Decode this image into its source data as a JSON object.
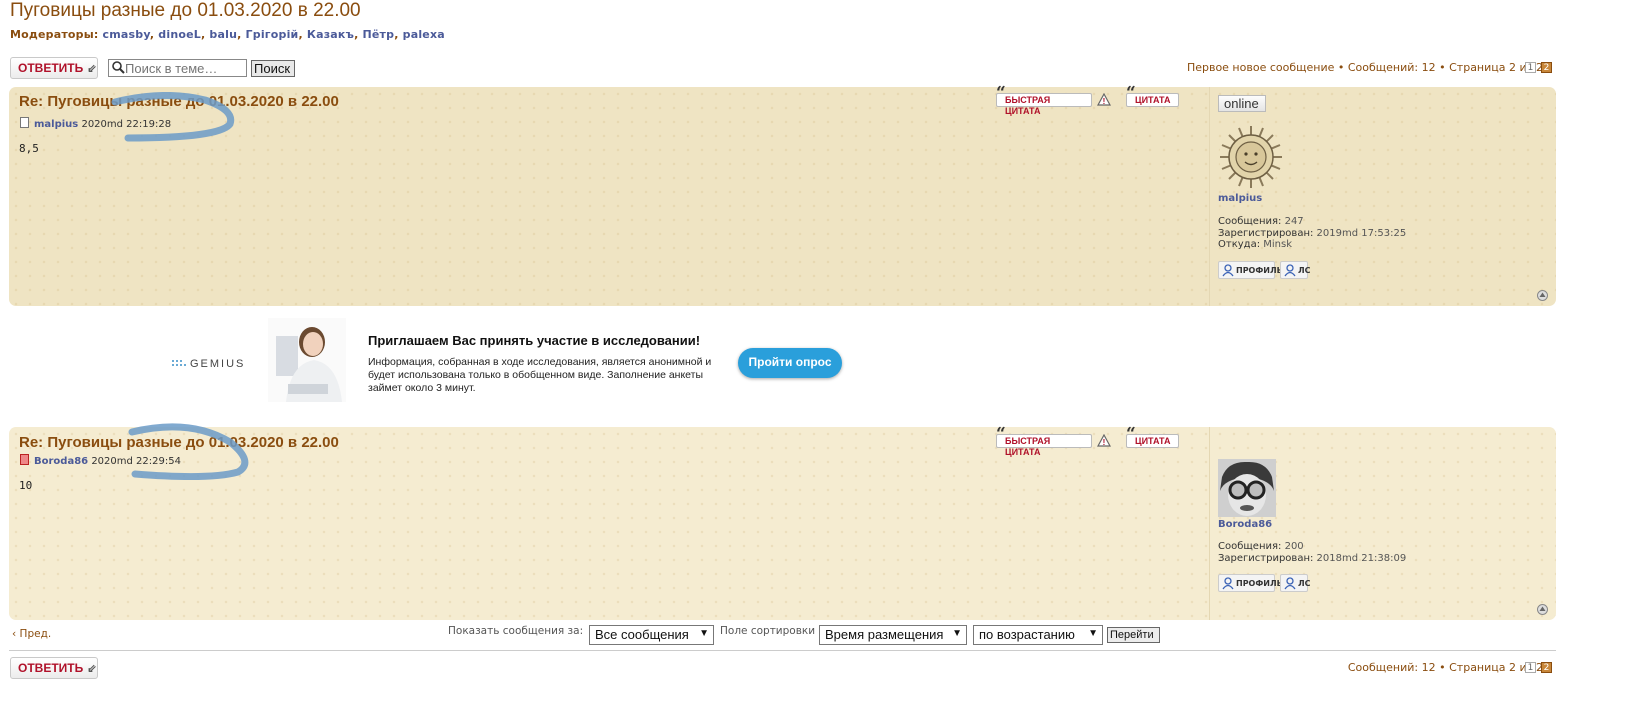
{
  "topic": {
    "title": "Пуговицы разные до 01.03.2020 в 22.00",
    "moderators_label": "Модераторы:",
    "moderators": [
      "cmasby",
      "dinoeL",
      "balu",
      "Грігорій",
      "Казакъ",
      "Пётр",
      "palexa"
    ]
  },
  "toolbar": {
    "reply_label": "ОТВЕТИТЬ",
    "search_placeholder": "Поиск в теме…",
    "search_button": "Поиск"
  },
  "pagination": {
    "first_new": "Первое новое сообщение",
    "messages": "Сообщений: 12",
    "page": "Страница 2 из 2",
    "pages": [
      "1",
      "2"
    ],
    "bullet": "•"
  },
  "posts": [
    {
      "title": "Re: Пуговицы разные до 01.03.2020 в 22.00",
      "author": "malpius",
      "date": "2020md 22:19:28",
      "content": "8,5",
      "quick_quote": "БЫСТРАЯ ЦИТАТА",
      "quote": "ЦИТАТА",
      "online": "online",
      "profile": {
        "name": "malpius",
        "stats": [
          {
            "label": "Сообщения:",
            "value": "247"
          },
          {
            "label": "Зарегистрирован:",
            "value": "2019md 17:53:25"
          },
          {
            "label": "Откуда:",
            "value": "Minsk"
          }
        ],
        "profile_btn": "ПРОФИЛЬ",
        "pm_btn": "ЛС"
      }
    },
    {
      "title": "Re: Пуговицы разные до 01.03.2020 в 22.00",
      "author": "Boroda86",
      "date": "2020md 22:29:54",
      "content": "10",
      "quick_quote": "БЫСТРАЯ ЦИТАТА",
      "quote": "ЦИТАТА",
      "profile": {
        "name": "Boroda86",
        "stats": [
          {
            "label": "Сообщения:",
            "value": "200"
          },
          {
            "label": "Зарегистрирован:",
            "value": "2018md 21:38:09"
          }
        ],
        "profile_btn": "ПРОФИЛЬ",
        "pm_btn": "ЛС"
      }
    }
  ],
  "ad": {
    "brand": "GEMIUS",
    "title": "Приглашаем Вас принять участие в исследовании!",
    "text": "Информация, собранная в ходе исследования, является анонимной и будет использована только в обобщенном виде. Заполнение анкеты займет около 3 минут.",
    "button": "Пройти опрос"
  },
  "bottom": {
    "prev": "Пред.",
    "show_label": "Показать сообщения за:",
    "show_value": "Все сообщения",
    "sort_label": "Поле сортировки",
    "sort_value": "Время размещения",
    "order_value": "по возрастанию",
    "go_button": "Перейти"
  },
  "colors": {
    "accent": "#8a4d0f",
    "link": "#4b5a99",
    "reply": "#b0112a",
    "ad_button": "#2a9fdb"
  }
}
